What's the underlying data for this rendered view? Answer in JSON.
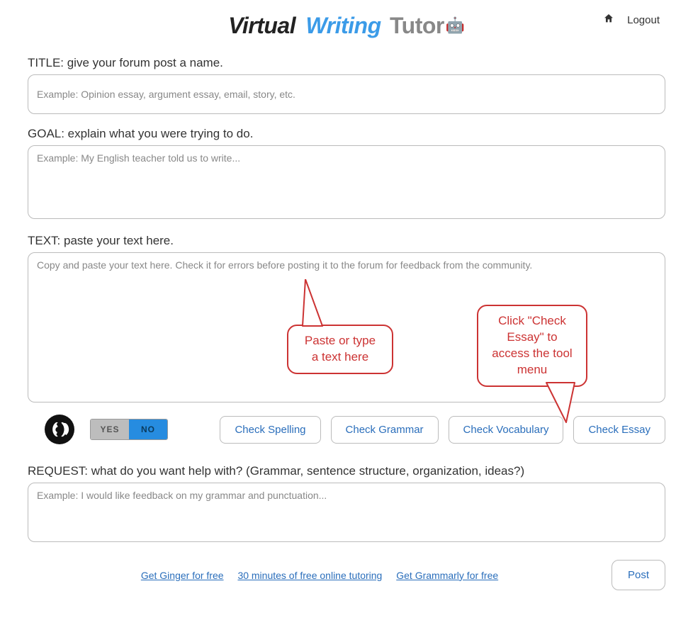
{
  "logo": {
    "w1": "Virtual",
    "w2": "Writing",
    "w3": "Tutor",
    "robot": "🤖"
  },
  "nav": {
    "home_icon": "⌂",
    "logout": "Logout"
  },
  "labels": {
    "title": "TITLE: give your forum post a name.",
    "goal": "GOAL: explain what you were trying to do.",
    "text": "TEXT: paste your text here.",
    "request": "REQUEST: what do you want help with? (Grammar, sentence structure, organization, ideas?)"
  },
  "placeholders": {
    "title": "Example: Opinion essay, argument essay, email, story, etc.",
    "goal": "Example: My English teacher told us to write...",
    "text": "Copy and paste your text here. Check it for errors before posting it to the forum for feedback from the community.",
    "request": "Example: I would like feedback on my grammar and punctuation..."
  },
  "toggle": {
    "yes": "YES",
    "no": "NO",
    "state": "no"
  },
  "buttons": {
    "spelling": "Check Spelling",
    "grammar": "Check Grammar",
    "vocabulary": "Check Vocabulary",
    "essay": "Check Essay",
    "post": "Post"
  },
  "links": {
    "ginger": "Get Ginger for free",
    "tutoring": "30 minutes of free online tutoring",
    "grammarly": "Get Grammarly for free"
  },
  "callouts": {
    "paste": "Paste or type a text here",
    "essay": "Click \"Check Essay\" to access the tool menu"
  }
}
